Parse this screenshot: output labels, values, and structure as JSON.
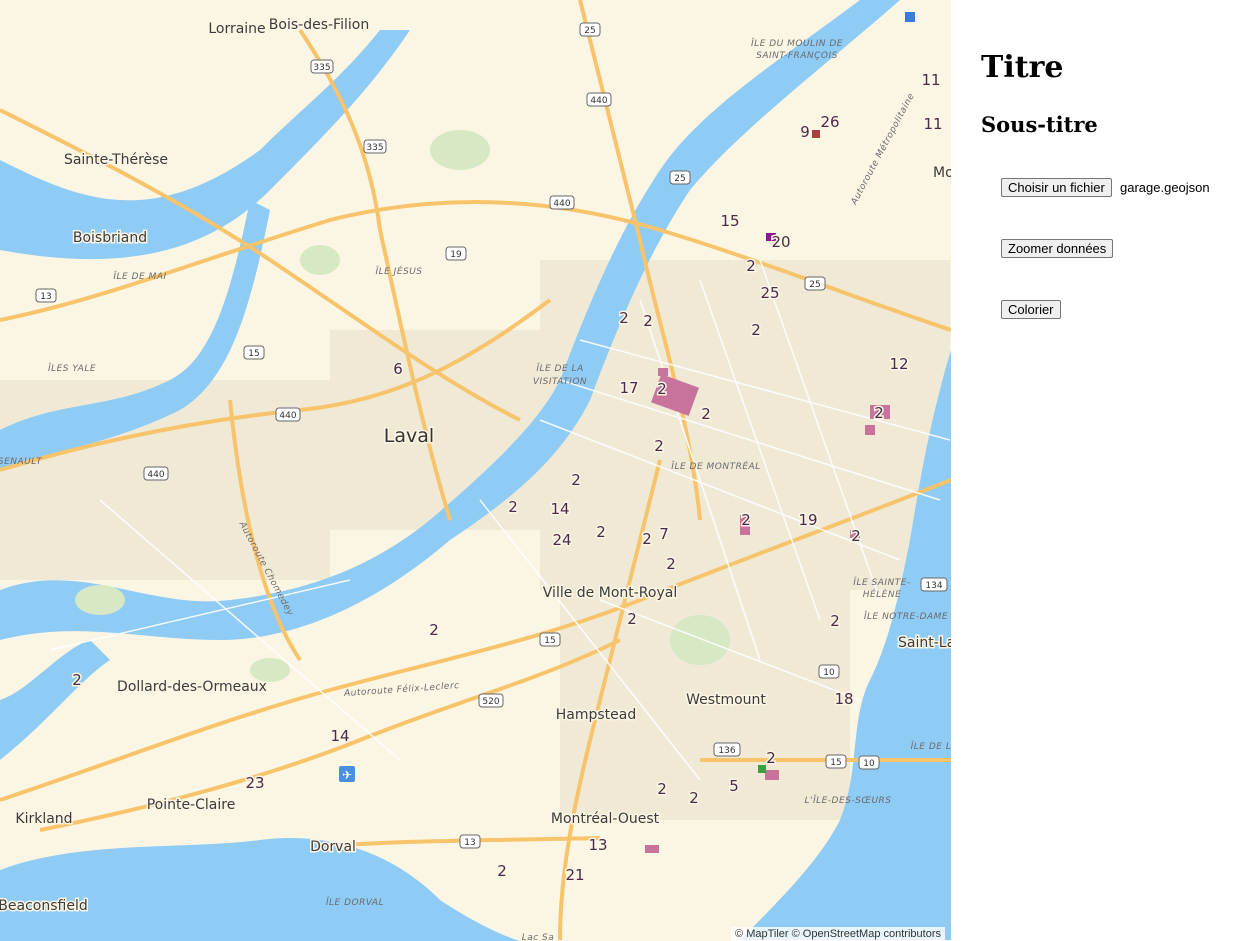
{
  "panel": {
    "title": "Titre",
    "subtitle": "Sous-titre",
    "file_button": "Choisir un fichier",
    "file_name": "garage.geojson",
    "zoom_button": "Zoomer données",
    "color_button": "Colorier"
  },
  "map": {
    "attribution": "© MapTiler © OpenStreetMap contributors",
    "places": [
      "Lorraine",
      "Bois-des-Filion",
      "Sainte-Thérèse",
      "Boisbriand",
      "Laval",
      "Ville de Mont-Royal",
      "Dollard-des-Ormeaux",
      "Westmount",
      "Hampstead",
      "Pointe-Claire",
      "Kirkland",
      "Dorval",
      "Montréal-Ouest",
      "Beaconsfield",
      "Saint-La",
      "Mo"
    ],
    "islands": [
      "ÎLE DU MOULIN DE",
      "SAINT-FRANÇOIS",
      "ÎLE JÉSUS",
      "ÎLE DE LA",
      "VISITATION",
      "ÎLE DE MAI",
      "ÎLES YALE",
      "ÎLE DE MONTRÉAL",
      "ÎLE SAINTE-",
      "HÉLÈNE",
      "ÎLE NOTRE-DAME",
      "L'ÎLE-DES-SŒURS",
      "ÎLE DORVAL",
      "ÎLE DE L",
      "Autoroute Métropolitaine",
      "Autoroute Chomedey",
      "Autoroute Félix-Leclerc",
      "SENAULT",
      "Lac Sa"
    ],
    "routes": [
      "25",
      "335",
      "440",
      "335",
      "25",
      "440",
      "19",
      "13",
      "15",
      "440",
      "440",
      "25",
      "15",
      "520",
      "134",
      "10",
      "136",
      "15",
      "10",
      "13"
    ],
    "counts": [
      "9",
      "26",
      "11",
      "11",
      "15",
      "20",
      "2",
      "25",
      "2",
      "2",
      "2",
      "12",
      "6",
      "17",
      "2",
      "2",
      "2",
      "2",
      "2",
      "14",
      "24",
      "2",
      "2",
      "7",
      "19",
      "2",
      "2",
      "2",
      "2",
      "2",
      "2",
      "18",
      "14",
      "23",
      "2",
      "2",
      "2",
      "5",
      "2",
      "13",
      "2",
      "21",
      "2"
    ]
  }
}
